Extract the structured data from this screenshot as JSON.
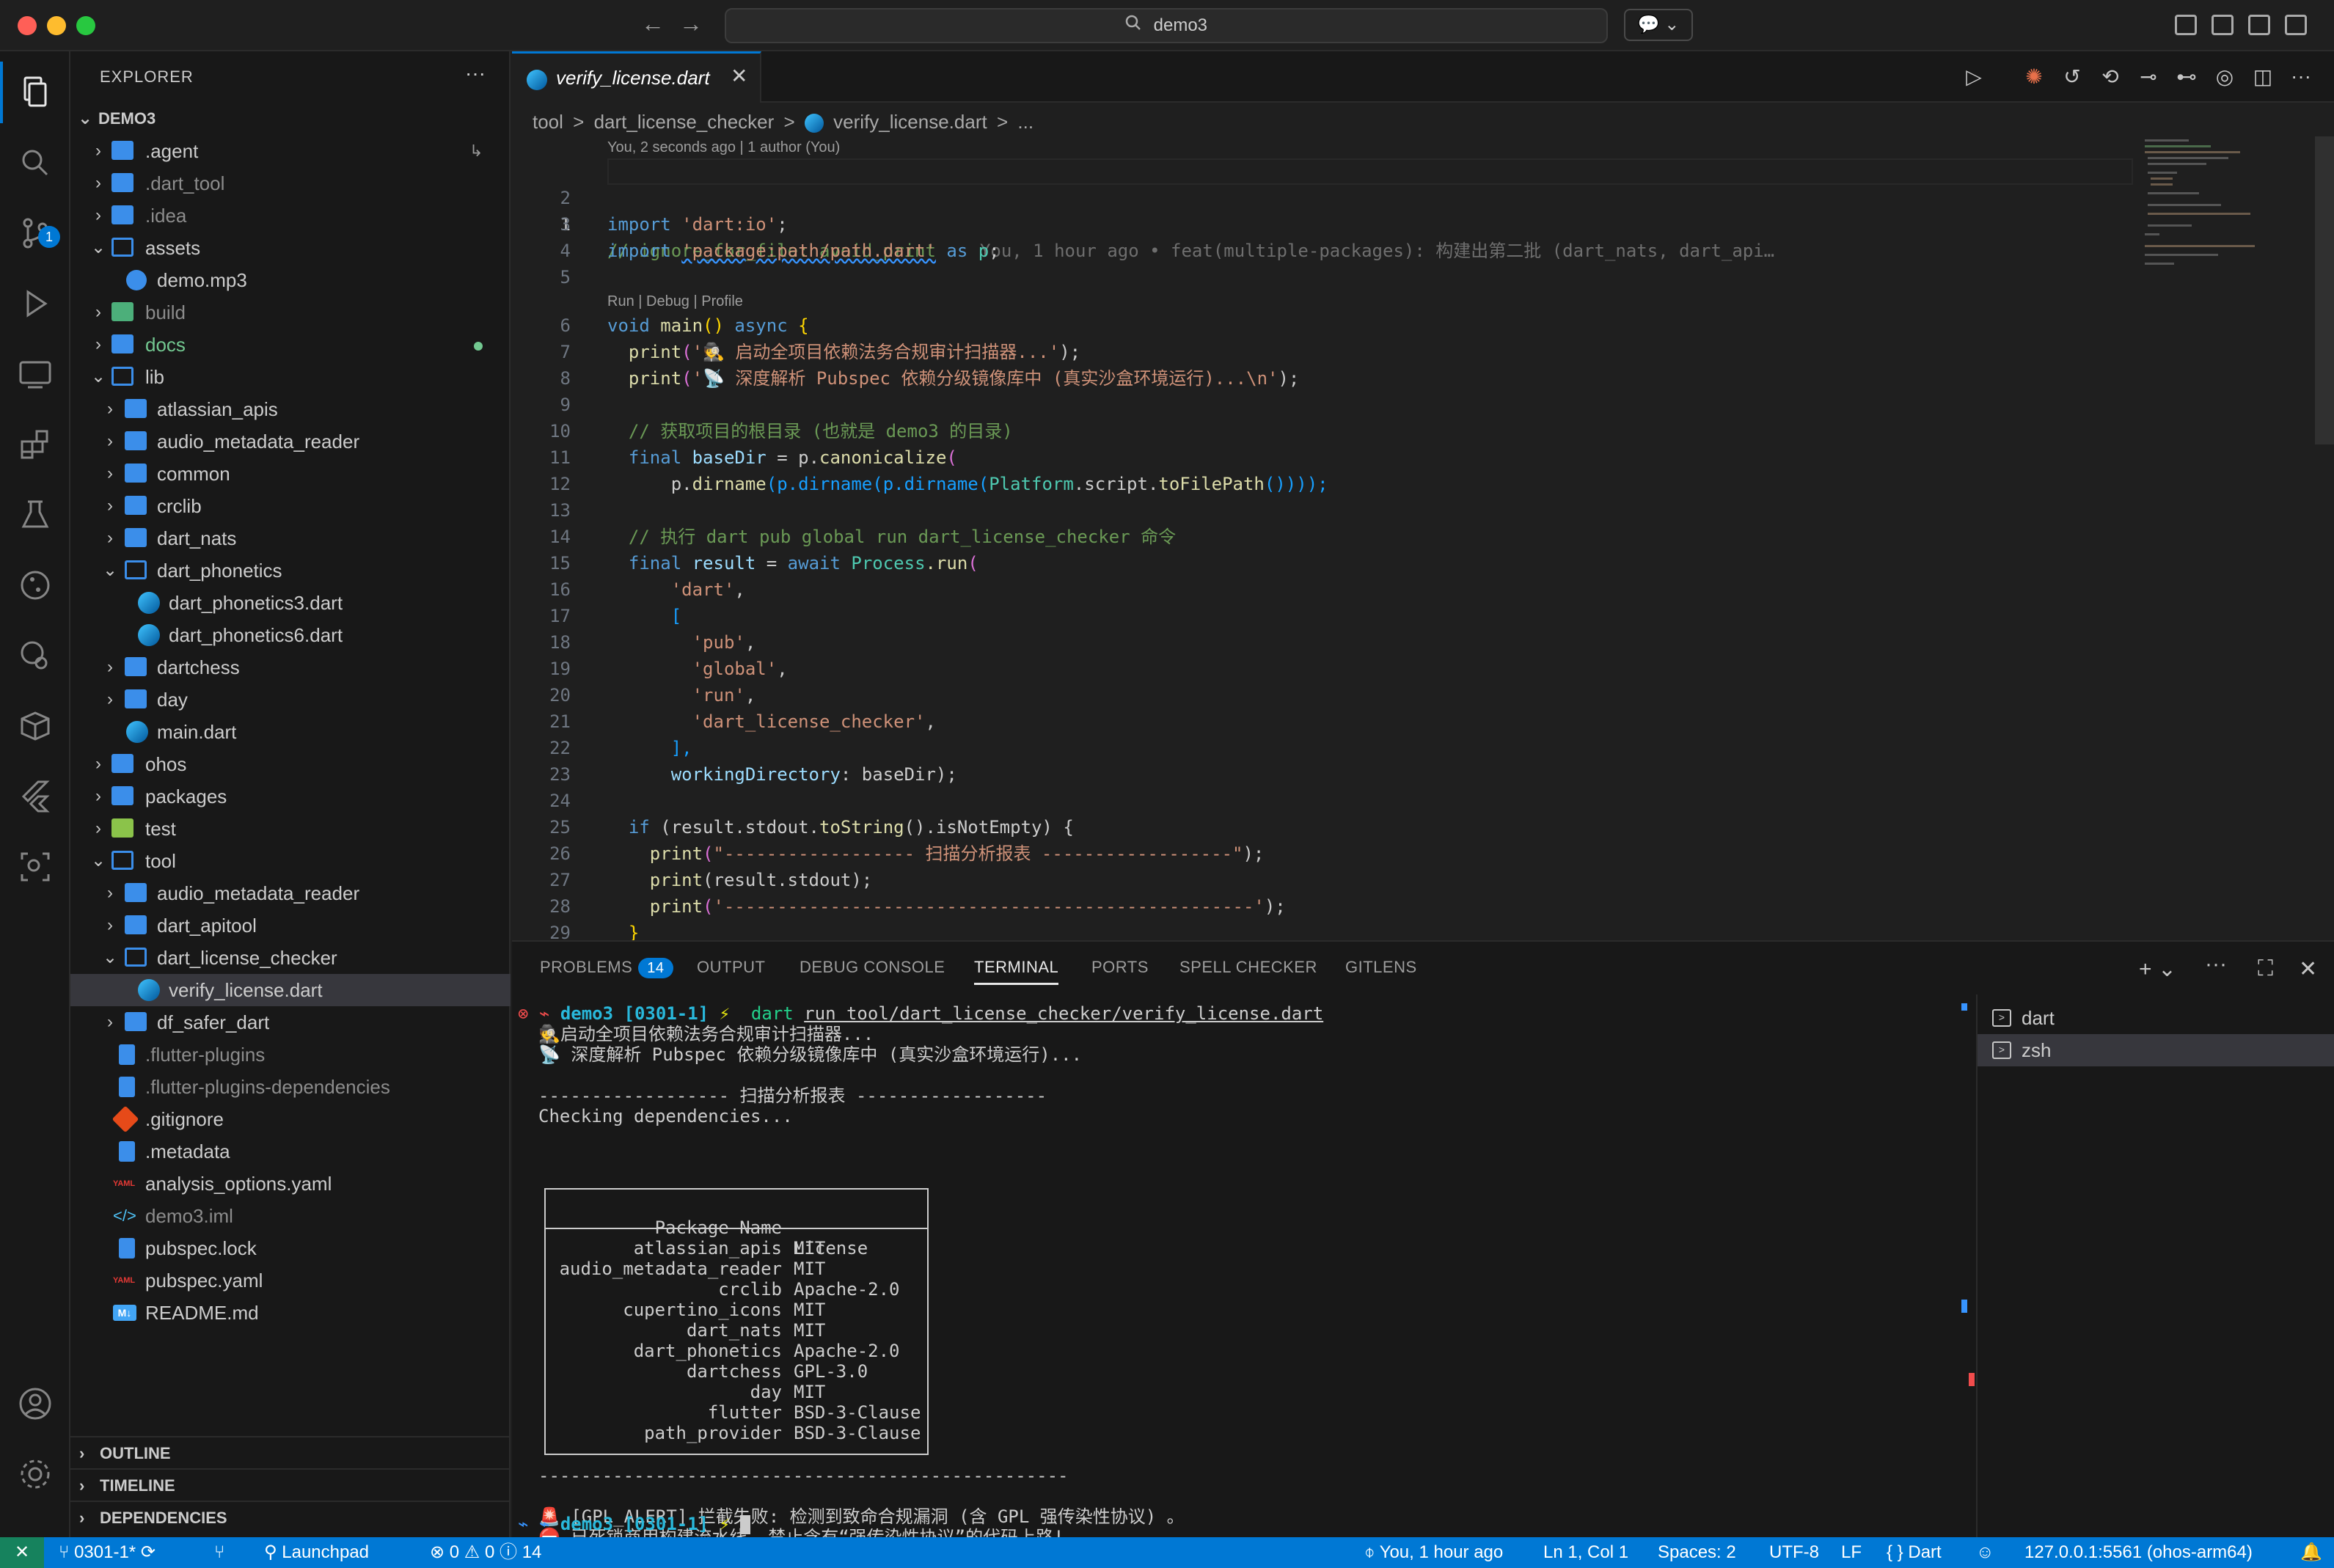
{
  "titlebar": {
    "search_text": "demo3",
    "back_arrow": "←",
    "forward_arrow": "→",
    "chat_glyph": "💬 ⌄"
  },
  "activity": {
    "scm_badge": "1"
  },
  "explorer": {
    "title": "EXPLORER",
    "more": "···",
    "root": "DEMO3",
    "agent_mark": "↳",
    "items": [
      {
        "label": ".agent"
      },
      {
        "label": ".dart_tool"
      },
      {
        "label": ".idea"
      },
      {
        "label": "assets"
      },
      {
        "label": "demo.mp3"
      },
      {
        "label": "build"
      },
      {
        "label": "docs"
      },
      {
        "label": "lib"
      },
      {
        "label": "atlassian_apis"
      },
      {
        "label": "audio_metadata_reader"
      },
      {
        "label": "common"
      },
      {
        "label": "crclib"
      },
      {
        "label": "dart_nats"
      },
      {
        "label": "dart_phonetics"
      },
      {
        "label": "dart_phonetics3.dart"
      },
      {
        "label": "dart_phonetics6.dart"
      },
      {
        "label": "dartchess"
      },
      {
        "label": "day"
      },
      {
        "label": "main.dart"
      },
      {
        "label": "ohos"
      },
      {
        "label": "packages"
      },
      {
        "label": "test"
      },
      {
        "label": "tool"
      },
      {
        "label": "audio_metadata_reader"
      },
      {
        "label": "dart_apitool"
      },
      {
        "label": "dart_license_checker"
      },
      {
        "label": "verify_license.dart"
      },
      {
        "label": "df_safer_dart"
      },
      {
        "label": ".flutter-plugins"
      },
      {
        "label": ".flutter-plugins-dependencies"
      },
      {
        "label": ".gitignore"
      },
      {
        "label": ".metadata"
      },
      {
        "label": "analysis_options.yaml"
      },
      {
        "label": "demo3.iml"
      },
      {
        "label": "pubspec.lock"
      },
      {
        "label": "pubspec.yaml"
      },
      {
        "label": "README.md"
      }
    ],
    "sections": [
      "OUTLINE",
      "TIMELINE",
      "DEPENDENCIES"
    ]
  },
  "editor": {
    "tab_label": "verify_license.dart",
    "tab_close": "✕",
    "breadcrumb": [
      "tool",
      ">",
      "dart_license_checker",
      ">",
      "verify_license.dart",
      ">",
      "..."
    ],
    "blame_header": "You, 2 seconds ago | 1 author (You)",
    "codelens": "Run | Debug | Profile",
    "blame_inline": "You, 1 hour ago • feat(multiple-packages): 构建出第二批 (dart_nats, dart_api…",
    "line_numbers": [
      "1",
      "2",
      "3",
      "4",
      "5",
      "6",
      "7",
      "8",
      "9",
      "10",
      "11",
      "12",
      "13",
      "14",
      "15",
      "16",
      "17",
      "18",
      "19",
      "20",
      "21",
      "22",
      "23",
      "24",
      "25",
      "26",
      "27",
      "28",
      "29"
    ],
    "code": {
      "l1": "// ignore_for_file: avoid_print",
      "l3_kw": "import",
      "l3_str": "'dart:io'",
      "l3_end": ";",
      "l4_kw": "import",
      "l4_str": "'package:path/path.dart'",
      "l4_as": "as",
      "l4_p": "p",
      "l4_end": ";",
      "l6_void": "void",
      "l6_main": "main",
      "l6_par": "()",
      "l6_async": "async",
      "l6_brace": "{",
      "l7_fn": "print",
      "l7_str": "'🕵️ 启动全项目依赖法务合规审计扫描器...'",
      "l7_end": ");",
      "l8_fn": "print",
      "l8_str": "'📡 深度解析 Pubspec 依赖分级镜像库中 (真实沙盒环境运行)...\\n'",
      "l8_end": ");",
      "l10": "// 获取项目的根目录 (也就是 demo3 的目录)",
      "l11_kw": "final",
      "l11_var": "baseDir",
      "l11_rest": " = p.",
      "l11_fn": "canonicalize",
      "l11_par": "(",
      "l12_pre": "p.",
      "l12_fn": "dirname",
      "l12_rest": "(p.dirname(p.dirname(",
      "l12_cls": "Platform",
      "l12_rest2": ".script.",
      "l12_fn2": "toFilePath",
      "l12_end": "())));",
      "l14": "// 执行 dart pub global run dart_license_checker 命令",
      "l15_kw": "final",
      "l15_var": "result",
      "l15_eq": " = ",
      "l15_await": "await",
      "l15_cls": "Process",
      "l15_fn": ".run",
      "l15_par": "(",
      "l16": "'dart'",
      "l16_end": ",",
      "l17": "[",
      "l18": "'pub'",
      "l19": "'global'",
      "l20": "'run'",
      "l21": "'dart_license_checker'",
      "comma": ",",
      "l22": "],",
      "l23_var": "workingDirectory",
      "l23_rest": ": baseDir);",
      "l25_if": "if",
      "l25_rest": " (result.stdout.",
      "l25_fn": "toString",
      "l25_rest2": "().isNotEmpty) {",
      "l26_fn": "print",
      "l26_str": "\"------------------ 扫描分析报表 ------------------\"",
      "l26_end": ");",
      "l27_fn": "print",
      "l27_rest": "(result.stdout);",
      "l28_fn": "print",
      "l28_str": "'--------------------------------------------------'",
      "l28_end": ");",
      "l29": "}"
    }
  },
  "panel": {
    "tabs": [
      "PROBLEMS",
      "OUTPUT",
      "DEBUG CONSOLE",
      "TERMINAL",
      "PORTS",
      "SPELL CHECKER",
      "GITLENS"
    ],
    "problems_count": "14",
    "actions": {
      "add": "+ ⌄",
      "more": "···",
      "maximize": "⛶",
      "close": "✕"
    },
    "terminal": {
      "prompt_dir": "demo3",
      "prompt_branch": "[0301-1]",
      "prompt_bolt": "⚡",
      "prompt_mark": "⊗ ⌁",
      "command_dart": "dart",
      "command_rest": "run tool/dart_license_checker/verify_license.dart",
      "out1": "🕵️启动全项目依赖法务合规审计扫描器...",
      "out2": "📡 深度解析 Pubspec 依赖分级镜像库中 (真实沙盒环境运行)...",
      "out3": "------------------ 扫描分析报表 ------------------",
      "out4": "Checking dependencies...",
      "table_header_name": "Package Name",
      "table_header_license": "License",
      "packages": [
        {
          "name": "atlassian_apis",
          "license": "MIT"
        },
        {
          "name": "audio_metadata_reader",
          "license": "MIT"
        },
        {
          "name": "crclib",
          "license": "Apache-2.0"
        },
        {
          "name": "cupertino_icons",
          "license": "MIT"
        },
        {
          "name": "dart_nats",
          "license": "MIT"
        },
        {
          "name": "dart_phonetics",
          "license": "Apache-2.0"
        },
        {
          "name": "dartchess",
          "license": "GPL-3.0"
        },
        {
          "name": "day",
          "license": "MIT"
        },
        {
          "name": "flutter",
          "license": "BSD-3-Clause"
        },
        {
          "name": "path_provider",
          "license": "BSD-3-Clause"
        }
      ],
      "out5": "--------------------------------------------------",
      "alert1": "🚨 [GPL_ALERT] 拦截失败: 检测到致命合规漏洞 (含 GPL 强传染性协议) 。",
      "alert2": "⛔ 已死锁商用构建流水线, 禁止含有“强传染性协议”的代码上路!",
      "prompt2_mark": "⌁ ⌁"
    },
    "terminal_list": [
      "dart",
      "zsh"
    ]
  },
  "statusbar": {
    "remote": "✕",
    "branch": "0301-1*",
    "sync": "⟳",
    "git_graph": "⑂",
    "launchpad": "Launchpad",
    "errors": "0",
    "warnings": "0",
    "infos": "14",
    "blame": "You, 1 hour ago",
    "position": "Ln 1, Col 1",
    "spaces": "Spaces: 2",
    "encoding": "UTF-8",
    "eol": "LF",
    "language": "Dart",
    "device": "127.0.0.1:5561 (ohos-arm64)",
    "bell": "🔔"
  },
  "colors": {
    "accent": "#0078d4",
    "statusbar": "#0078d4",
    "background": "#1f1f1f"
  }
}
